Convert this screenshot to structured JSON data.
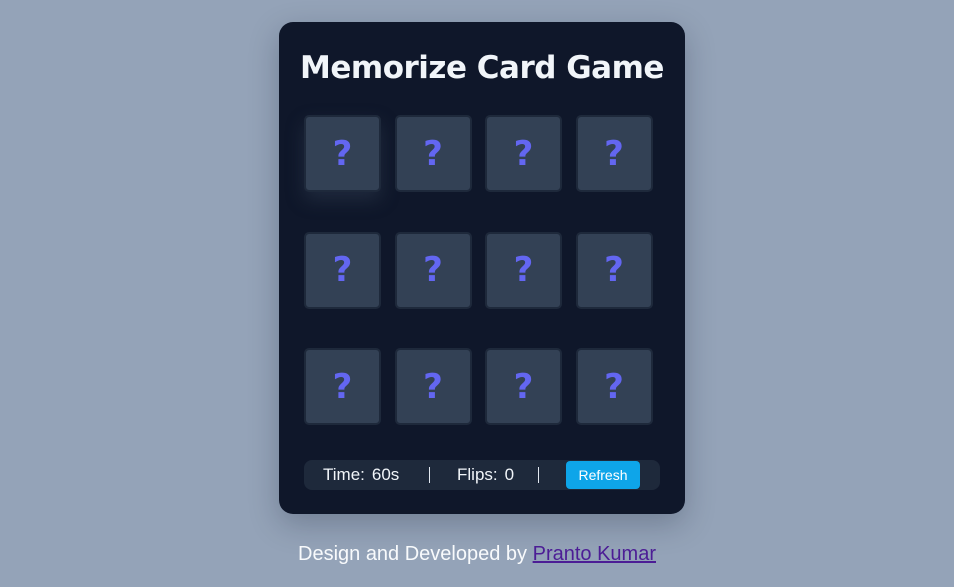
{
  "game": {
    "title": "Memorize Card Game",
    "cards": [
      "?",
      "?",
      "?",
      "?",
      "?",
      "?",
      "?",
      "?",
      "?",
      "?",
      "?",
      "?"
    ],
    "stats": {
      "time_label": "Time:",
      "time_value": "60s",
      "flips_label": "Flips:",
      "flips_value": "0"
    },
    "refresh_label": "Refresh"
  },
  "credit": {
    "prefix": "Design and Developed by",
    "author": "Pranto Kumar"
  },
  "colors": {
    "page_background": "#94a3b8",
    "panel_background": "#0f172a",
    "card_back": "#334155",
    "question_mark": "#6366f1",
    "refresh_button": "#0ea5e9",
    "author_link": "#4c1d95"
  }
}
